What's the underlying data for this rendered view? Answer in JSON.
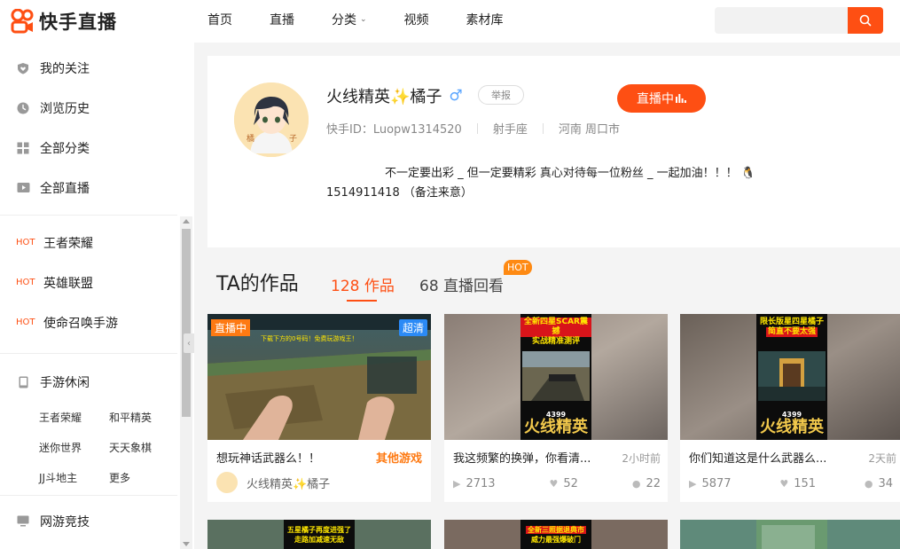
{
  "header": {
    "logo_text": "快手直播",
    "nav": [
      {
        "label": "首页"
      },
      {
        "label": "直播"
      },
      {
        "label": "分类"
      },
      {
        "label": "视频"
      },
      {
        "label": "素材库"
      }
    ],
    "search_placeholder": ""
  },
  "sidebar": {
    "main": [
      {
        "label": "我的关注",
        "icon": "heart-shield-icon"
      },
      {
        "label": "浏览历史",
        "icon": "clock-icon"
      },
      {
        "label": "全部分类",
        "icon": "grid-icon"
      },
      {
        "label": "全部直播",
        "icon": "video-icon"
      }
    ],
    "hot_tag": "HOT",
    "hot": [
      {
        "label": "王者荣耀"
      },
      {
        "label": "英雄联盟"
      },
      {
        "label": "使命召唤手游"
      }
    ],
    "group1": {
      "label": "手游休闲",
      "items": [
        "王者荣耀",
        "和平精英",
        "迷你世界",
        "天天象棋",
        "JJ斗地主",
        "更多"
      ]
    },
    "group2": {
      "label": "网游竞技"
    }
  },
  "profile": {
    "name": "火线精英✨橘子",
    "gender_symbol": "♂",
    "report_label": "举报",
    "live_label": "直播中",
    "id_text": "快手ID：Luopw1314520",
    "constellation": "射手座",
    "location": "河南 周口市",
    "bio_line1": "不一定要出彩 _ 但一定要精彩   真心对待每一位粉丝 _ 一起加油！！！  🐧",
    "bio_line2": "1514911418 （备注来意）"
  },
  "works": {
    "title": "TA的作品",
    "tab_works": "128 作品",
    "tab_replay": "68 直播回看",
    "hot_badge": "HOT"
  },
  "cards": [
    {
      "title": "想玩神话武器么！！",
      "category": "其他游戏",
      "author": "火线精英✨橘子",
      "live_tag": "直播中",
      "hd_tag": "超清"
    },
    {
      "title": "我这频繁的换弹，你看清...",
      "time": "2小时前",
      "plays": "2713",
      "likes": "52",
      "comments": "22",
      "poster_top1": "全新四星SCAR震撼",
      "poster_top2": "实战精准测评",
      "poster_brand": "火线精英",
      "poster_num": "4399"
    },
    {
      "title": "你们知道这是什么武器么...",
      "time": "2天前",
      "plays": "5877",
      "likes": "151",
      "comments": "34",
      "poster_top1": "限长版星四星橘子",
      "poster_top2": "简直不要太强",
      "poster_brand": "火线精英",
      "poster_num": "4399"
    }
  ],
  "row2": [
    {
      "poster_top1": "五星橘子再度进强了",
      "poster_top2": "走路加减速无敌"
    },
    {
      "poster_top1": "全新三照据退典市",
      "poster_top2": "威力最强爆破门"
    },
    {
      "poster_top1": "",
      "poster_top2": ""
    }
  ],
  "colors": {
    "accent": "#fe4f13",
    "hot": "#fe8a13",
    "hd": "#2b8af6"
  }
}
